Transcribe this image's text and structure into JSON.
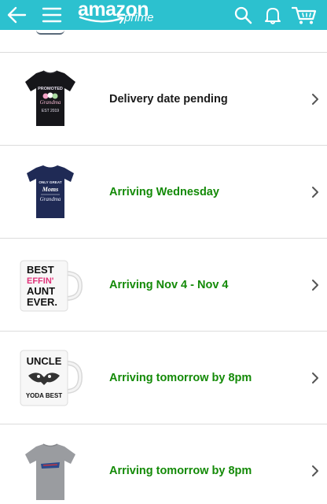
{
  "header": {
    "logo_word": "amazon",
    "logo_sub": "prime",
    "accent_color": "#2cc1cf",
    "icons": [
      "back-arrow-icon",
      "hamburger-menu-icon",
      "search-icon",
      "bell-icon",
      "cart-icon"
    ]
  },
  "orders": [
    {
      "product": "tshirt",
      "status": "Delivery date pending",
      "status_kind": "pending",
      "thumb_text": [
        "PROMOTED",
        "Grandma",
        "EST 2019"
      ]
    },
    {
      "product": "tshirt",
      "status": "Arriving Wednesday",
      "status_kind": "green",
      "thumb_text": [
        "ONLY GREAT",
        "Moms",
        "Grandma"
      ]
    },
    {
      "product": "mug",
      "status": "Arriving Nov 4 - Nov 4",
      "status_kind": "green",
      "thumb_text": [
        "BEST",
        "EFFIN'",
        "AUNT",
        "EVER."
      ]
    },
    {
      "product": "mug",
      "status": "Arriving tomorrow by 8pm",
      "status_kind": "green",
      "thumb_text": [
        "UNCLE",
        "YODA BEST"
      ]
    },
    {
      "product": "tshirt",
      "status": "Arriving tomorrow by 8pm",
      "status_kind": "green",
      "thumb_text": []
    }
  ],
  "colors": {
    "status_green": "#138a07",
    "status_pending": "#1a1a1a",
    "divider": "#dcdcdc",
    "chevron": "#555555"
  }
}
